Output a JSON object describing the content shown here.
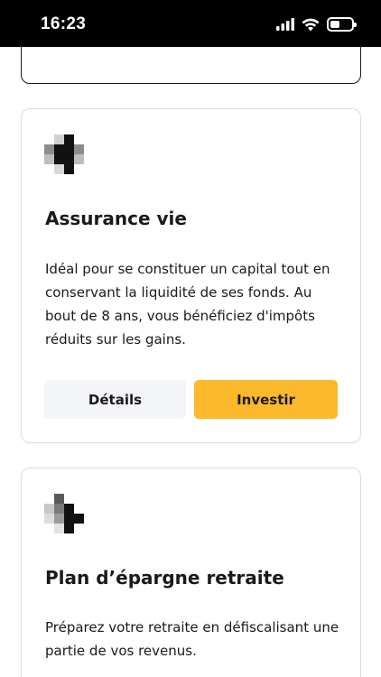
{
  "status_bar": {
    "time": "16:23",
    "icons": [
      "signal-icon",
      "wifi-icon",
      "battery-icon"
    ],
    "battery_level": 0.45
  },
  "cards": [
    {
      "title": "Assurance vie",
      "description": "Idéal pour se constituer un capital tout en conservant la liquidité de ses fonds. Au bout de 8 ans, vous bénéficiez d'impôts réduits sur les gains.",
      "details_label": "Détails",
      "invest_label": "Investir"
    },
    {
      "title": "Plan d’épargne retraite",
      "description": "Préparez votre retraite en défiscalisant une partie de vos revenus."
    }
  ],
  "colors": {
    "primary_button": "#fbb92b",
    "secondary_button": "#f4f5f8",
    "card_border": "#dcdcdc",
    "text": "#1a1a1a"
  }
}
